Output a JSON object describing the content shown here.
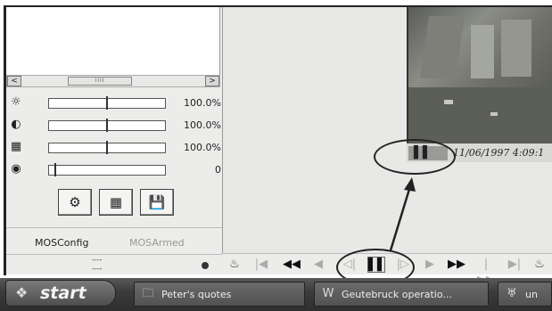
{
  "left_panel": {
    "scroll": {
      "left_arrow": "<",
      "right_arrow": ">",
      "thumb_grip": "IIII"
    },
    "sliders": [
      {
        "icon": "brightness-icon",
        "glyph": "☼",
        "value": "100.0%"
      },
      {
        "icon": "contrast-icon",
        "glyph": "◐",
        "value": "100.0%"
      },
      {
        "icon": "color-icon",
        "glyph": "▦",
        "value": "100.0%"
      },
      {
        "icon": "sharpness-icon",
        "glyph": "◉",
        "value": "0"
      }
    ],
    "tools": [
      {
        "icon": "settings-gear-icon",
        "glyph": "⚙"
      },
      {
        "icon": "calendar-grid-icon",
        "glyph": "▦"
      },
      {
        "icon": "save-disk-icon",
        "glyph": "💾"
      }
    ],
    "tabs": {
      "mosconfig": "MOSConfig",
      "mosarmed": "MOSArmed"
    },
    "status": {
      "line1": "----",
      "line2": "----"
    }
  },
  "video": {
    "pause_glyph": "▌▌",
    "timestamp": "11/06/1997 4:09:1"
  },
  "transport": [
    {
      "name": "camera-left-icon",
      "glyph": "♨",
      "style": ""
    },
    {
      "name": "skip-start-icon",
      "glyph": "|◀",
      "style": "faded"
    },
    {
      "name": "fast-rewind-icon",
      "glyph": "◀◀",
      "style": "dark"
    },
    {
      "name": "rewind-icon",
      "glyph": "◀",
      "style": "faded"
    },
    {
      "name": "step-back-icon",
      "glyph": "◁|",
      "style": "faded"
    },
    {
      "name": "pause-icon",
      "glyph": "▌▌",
      "style": "dark"
    },
    {
      "name": "step-forward-icon",
      "glyph": "|▷",
      "style": "faded"
    },
    {
      "name": "play-icon",
      "glyph": "▶",
      "style": "faded"
    },
    {
      "name": "fast-forward-icon",
      "glyph": "▶▶",
      "style": "dark"
    },
    {
      "name": "slow-forward-icon",
      "glyph": "|▶▶",
      "style": "faded"
    },
    {
      "name": "skip-end-icon",
      "glyph": "▶|",
      "style": "faded"
    },
    {
      "name": "camera-right-icon",
      "glyph": "♨",
      "style": ""
    }
  ],
  "taskbar": {
    "start_label": "start",
    "start_glyph": "❖",
    "tasks": [
      {
        "icon": "folder-icon",
        "glyph": "🗀",
        "label": "Peter's quotes"
      },
      {
        "icon": "word-document-icon",
        "glyph": "W",
        "label": "Geutebruck operatio..."
      },
      {
        "icon": "app-icon",
        "glyph": "♅",
        "label": "un"
      }
    ]
  },
  "colors": {
    "taskbar": "#3c3c3c",
    "annotation": "#222222"
  }
}
